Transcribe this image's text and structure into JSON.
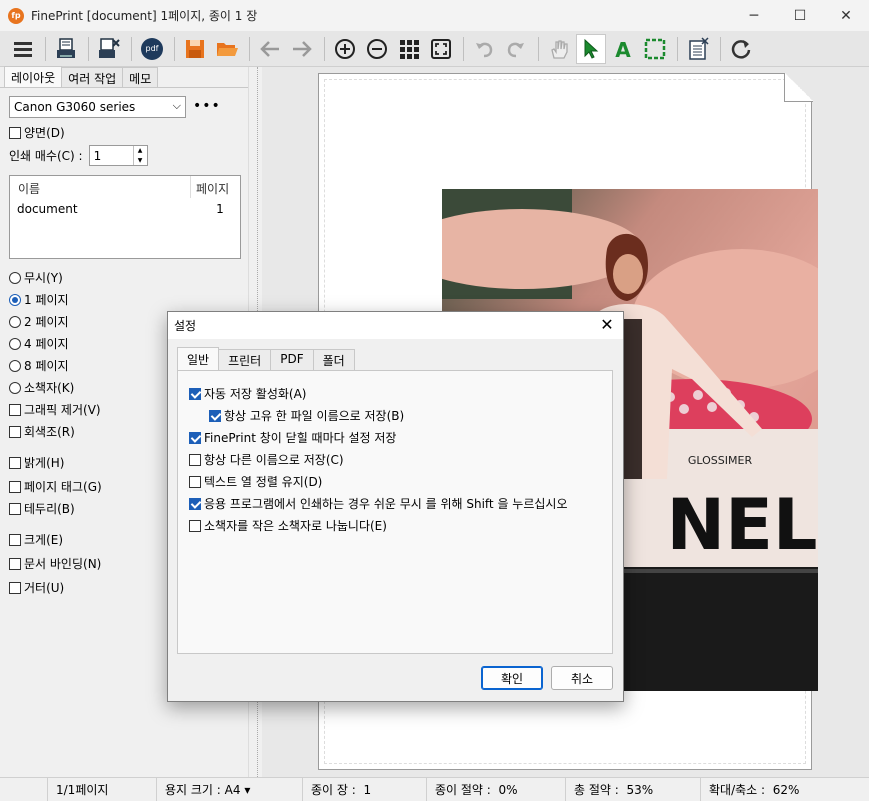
{
  "window": {
    "app_icon_text": "fp",
    "title": "FinePrint [document] 1페이지, 종이 1 장",
    "minimize": "─",
    "maximize": "☐",
    "close": "✕"
  },
  "toolbar": {
    "icons": [
      "menu-icon",
      "print-icon",
      "delete-job-icon",
      "pdf-icon",
      "save-icon",
      "open-folder-icon",
      "back-arrow-icon",
      "forward-arrow-icon",
      "zoom-in-icon",
      "zoom-out-icon",
      "grid-icon",
      "fit-icon",
      "undo-icon",
      "redo-icon",
      "hand-icon",
      "pointer-icon",
      "text-icon",
      "select-rect-icon",
      "notes-icon",
      "refresh-icon"
    ],
    "pdf_label": "pdf",
    "text_tool_label": "A"
  },
  "left_panel": {
    "tabs": [
      "레이아웃",
      "여러 작업",
      "메모"
    ],
    "printer": "Canon G3060 series",
    "more_label": "•••",
    "duplex_label": "양면(D)",
    "copies_label": "인쇄 매수(C) :",
    "copies_value": "1",
    "doc_list": {
      "col_name": "이름",
      "col_pages": "페이지",
      "rows": [
        {
          "name": "document",
          "pages": "1"
        }
      ]
    },
    "layout_options": [
      {
        "label": "무시(Y)",
        "selected": false
      },
      {
        "label": "1 페이지",
        "selected": true
      },
      {
        "label": "2 페이지",
        "selected": false
      },
      {
        "label": "4 페이지",
        "selected": false
      },
      {
        "label": "8 페이지",
        "selected": false
      },
      {
        "label": "소책자(K)",
        "selected": false
      }
    ],
    "checkboxes_group1": [
      "그래픽 제거(V)",
      "회색조(R)"
    ],
    "checkboxes_group2": [
      "밝게(H)",
      "페이지 태그(G)",
      "테두리(B)"
    ],
    "checkboxes_group3": [
      "크게(E)",
      "문서 바인딩(N)",
      "거터(U)"
    ]
  },
  "preview": {
    "photo_text_brand": "GLOSSIMER",
    "photo_text_big": "NEL"
  },
  "status_bar": {
    "page": "1/1페이지",
    "paper_size_label": "용지 크기 :",
    "paper_size_value": "A4",
    "sheets_label": "종이 장 :",
    "sheets_value": "1",
    "paper_saved_label": "종이 절약 :",
    "paper_saved_value": "0%",
    "total_saved_label": "총 절약 :",
    "total_saved_value": "53%",
    "zoom_label": "확대/축소 :",
    "zoom_value": "62%"
  },
  "dialog": {
    "title": "설정",
    "tabs": [
      "일반",
      "프린터",
      "PDF",
      "폴더"
    ],
    "options": [
      {
        "label": "자동 저장 활성화(A)",
        "checked": true,
        "indent": false
      },
      {
        "label": "항상 고유 한 파일 이름으로 저장(B)",
        "checked": true,
        "indent": true
      },
      {
        "label": "FinePrint 창이 닫힐 때마다 설정 저장",
        "checked": true,
        "indent": false
      },
      {
        "label": "항상 다른 이름으로 저장(C)",
        "checked": false,
        "indent": false
      },
      {
        "label": "텍스트 열 정렬 유지(D)",
        "checked": false,
        "indent": false
      },
      {
        "label": "응용 프로그램에서 인쇄하는 경우 쉬운 무시 를 위해 Shift 을 누르십시오",
        "checked": true,
        "indent": false
      },
      {
        "label": "소책자를 작은 소책자로 나눕니다(E)",
        "checked": false,
        "indent": false
      }
    ],
    "ok_label": "확인",
    "cancel_label": "취소"
  },
  "colors": {
    "accent": "#1d5fb8",
    "save_icon": "#e8741e",
    "pointer_icon": "#1b8a2e",
    "dialog_ok_border": "#0a64d0"
  }
}
